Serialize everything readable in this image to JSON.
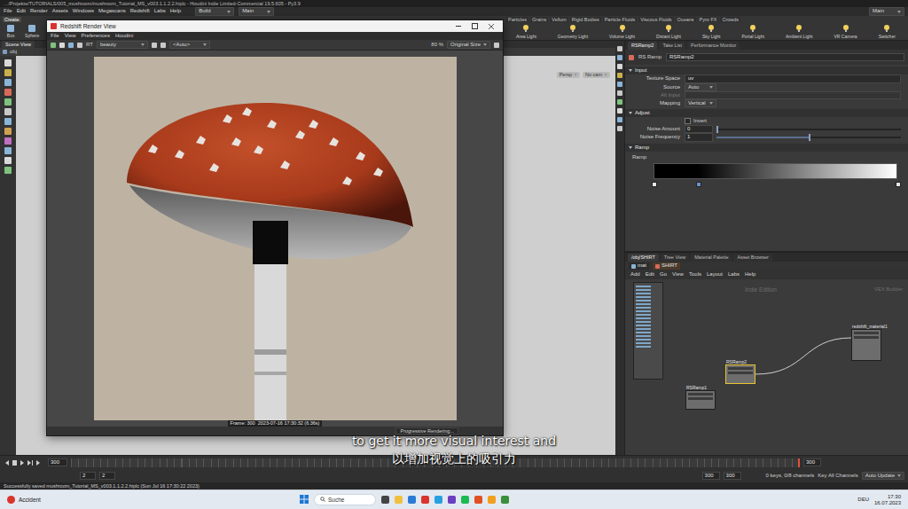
{
  "titlebar": {
    "title": "…/Projekte/TUTORIALS/005_mushroom/mushroom_Tutorial_MS_v003.1.1.2.2.hiplc - Houdini Indie Limited-Commercial 19.5.605 - Py3.9"
  },
  "menubar": {
    "items": [
      "File",
      "Edit",
      "Render",
      "Assets",
      "Windows",
      "Megascans",
      "Redshift",
      "Labs",
      "Help"
    ],
    "desktop": "Build",
    "context": "Main",
    "right": "Main"
  },
  "shelf": {
    "left_tab": "Create",
    "left_tools": [
      "Box",
      "Sphere"
    ],
    "tabs": [
      {
        "label": "Particles",
        "selected": false
      },
      {
        "label": "Grains",
        "selected": false
      },
      {
        "label": "Vellum",
        "selected": false
      },
      {
        "label": "Rigid Bodies",
        "selected": false
      },
      {
        "label": "Particle Fluids",
        "selected": false
      },
      {
        "label": "Viscous Fluids",
        "selected": false
      },
      {
        "label": "Oceans",
        "selected": false
      },
      {
        "label": "Pyro FX",
        "selected": false
      },
      {
        "label": "Crowds",
        "selected": false
      }
    ],
    "tools": [
      "Area Light",
      "Geometry Light",
      "Volume Light",
      "Distant Light",
      "Sky Light",
      "Portal Light",
      "Ambient Light",
      "VR Camera",
      "Switcher"
    ]
  },
  "viewport": {
    "tab": "Scene View",
    "path": "obj",
    "camera": "Persp",
    "camera_name": "No cam"
  },
  "render_view": {
    "title": "Redshift Render View",
    "menu": [
      "File",
      "View",
      "Preferences",
      "Houdini"
    ],
    "mode": "RT",
    "aov": "beauty",
    "camera": "<Auto>",
    "zoom": "80 %",
    "size": "Original Size",
    "caption": "Frame: 300  2023-07-16 17:30:32 (6.36s)",
    "status": "Progressive Rendering..."
  },
  "parameters": {
    "tabs": [
      {
        "label": "RSRamp2",
        "selected": true
      },
      {
        "label": "Take List",
        "selected": false
      },
      {
        "label": "Performance Monitor",
        "selected": false
      }
    ],
    "node_type": "RS Ramp",
    "node_name": "RSRamp2",
    "sections": [
      {
        "title": "Input",
        "expanded": true,
        "rows": [
          {
            "kind": "field",
            "label": "Texture Space",
            "value": "uv",
            "disabled": false
          },
          {
            "kind": "menu",
            "label": "Source",
            "value": "Auto",
            "disabled": false
          },
          {
            "kind": "field",
            "label": "Alt Input",
            "value": "",
            "disabled": true
          },
          {
            "kind": "menu",
            "label": "Mapping",
            "value": "Vertical",
            "disabled": false
          }
        ]
      },
      {
        "title": "Adjust",
        "expanded": true,
        "rows": [
          {
            "kind": "checkbox",
            "label": "Invert",
            "checked": false
          },
          {
            "kind": "slider",
            "label": "Noise Amount",
            "value": "0",
            "level": 0
          },
          {
            "kind": "slider",
            "label": "Noise Frequency",
            "value": "1",
            "level": 0.5
          }
        ]
      }
    ],
    "ramp": {
      "title": "Ramp",
      "label": "Ramp",
      "expanded": true,
      "keys": [
        {
          "level": 0,
          "value": 0,
          "selected": false
        },
        {
          "level": 0.18,
          "value": 0,
          "selected": true
        },
        {
          "level": 1,
          "value": 1,
          "selected": false
        }
      ]
    }
  },
  "network": {
    "tabs": [
      {
        "label": "/obj/SHIRT",
        "selected": true
      },
      {
        "label": "Tree View",
        "selected": false
      },
      {
        "label": "Material Palette",
        "selected": false
      },
      {
        "label": "Asset Browser",
        "selected": false
      }
    ],
    "path": [
      "mat",
      "SHIRT"
    ],
    "menu": [
      "Add",
      "Edit",
      "Go",
      "View",
      "Tools",
      "Layout",
      "Labs",
      "Help"
    ],
    "watermark": "Indie Edition",
    "context": "VEX Builder",
    "nodes": [
      {
        "name": "RSRamp2",
        "selected": true
      },
      {
        "name": "RSRamp1",
        "selected": false
      },
      {
        "name": "redshift_material1",
        "selected": false
      }
    ]
  },
  "timeline": {
    "frame": "300",
    "end": "300",
    "start": "2",
    "start2": "2",
    "range_end": "300",
    "range_end2": "300",
    "keys": "0 keys, 0/8 channels",
    "key_all": "Key All Channels",
    "update": "Auto Update"
  },
  "status_bar": {
    "text": "Successfully saved mushroom_Tutorial_MS_v003.1.1.2.2.hiplc (Sun Jul 16 17:30:22 2023)"
  },
  "subtitles": {
    "lines": [
      "to get it more visual interest and",
      "以增加视觉上的吸引力"
    ]
  },
  "taskbar": {
    "weather": "Accident",
    "search": "Suche",
    "language": "DEU",
    "time": "17:30",
    "date": "16.07.2023"
  }
}
